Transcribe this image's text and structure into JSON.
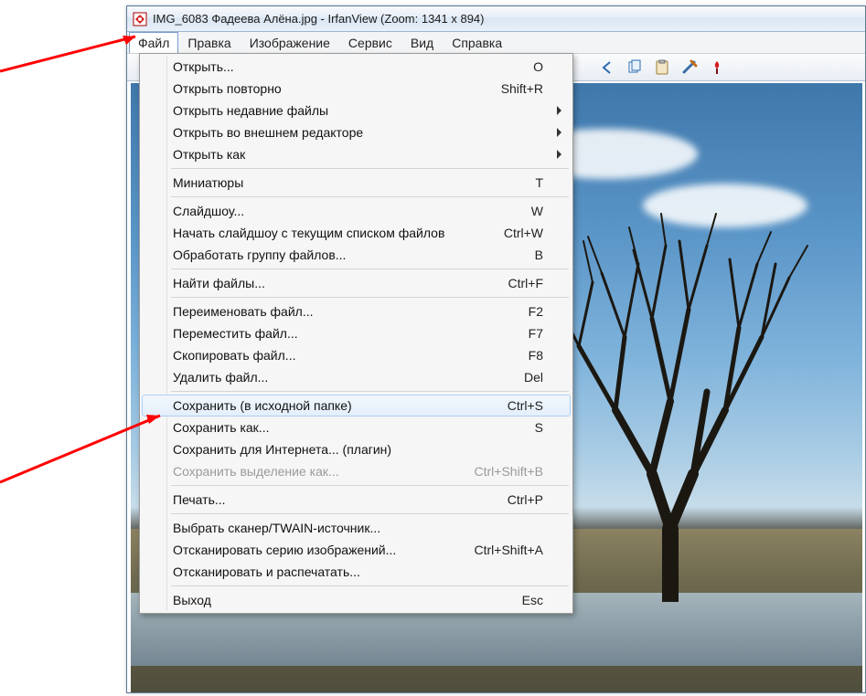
{
  "titlebar": {
    "text": "IMG_6083 Фадеева Алёна.jpg - IrfanView (Zoom: 1341 x 894)"
  },
  "menubar": {
    "items": [
      "Файл",
      "Правка",
      "Изображение",
      "Сервис",
      "Вид",
      "Справка"
    ],
    "active_index": 0
  },
  "file_menu": [
    {
      "label": "Открыть...",
      "shortcut": "O"
    },
    {
      "label": "Открыть повторно",
      "shortcut": "Shift+R"
    },
    {
      "label": "Открыть недавние файлы",
      "submenu": true
    },
    {
      "label": "Открыть во внешнем редакторе",
      "submenu": true
    },
    {
      "label": "Открыть как",
      "submenu": true
    },
    {
      "sep": true
    },
    {
      "label": "Миниатюры",
      "shortcut": "T"
    },
    {
      "sep": true
    },
    {
      "label": "Слайдшоу...",
      "shortcut": "W"
    },
    {
      "label": "Начать слайдшоу с текущим списком файлов",
      "shortcut": "Ctrl+W"
    },
    {
      "label": "Обработать группу файлов...",
      "shortcut": "B"
    },
    {
      "sep": true
    },
    {
      "label": "Найти файлы...",
      "shortcut": "Ctrl+F"
    },
    {
      "sep": true
    },
    {
      "label": "Переименовать файл...",
      "shortcut": "F2"
    },
    {
      "label": "Переместить файл...",
      "shortcut": "F7"
    },
    {
      "label": "Скопировать файл...",
      "shortcut": "F8"
    },
    {
      "label": "Удалить файл...",
      "shortcut": "Del"
    },
    {
      "sep": true
    },
    {
      "label": "Сохранить (в исходной папке)",
      "shortcut": "Ctrl+S",
      "hover": true
    },
    {
      "label": "Сохранить как...",
      "shortcut": "S"
    },
    {
      "label": "Сохранить для Интернета... (плагин)"
    },
    {
      "label": "Сохранить выделение как...",
      "shortcut": "Ctrl+Shift+B",
      "disabled": true
    },
    {
      "sep": true
    },
    {
      "label": "Печать...",
      "shortcut": "Ctrl+P"
    },
    {
      "sep": true
    },
    {
      "label": "Выбрать сканер/TWAIN-источник..."
    },
    {
      "label": "Отсканировать серию изображений...",
      "shortcut": "Ctrl+Shift+A"
    },
    {
      "label": "Отсканировать и распечатать..."
    },
    {
      "sep": true
    },
    {
      "label": "Выход",
      "shortcut": "Esc"
    }
  ]
}
